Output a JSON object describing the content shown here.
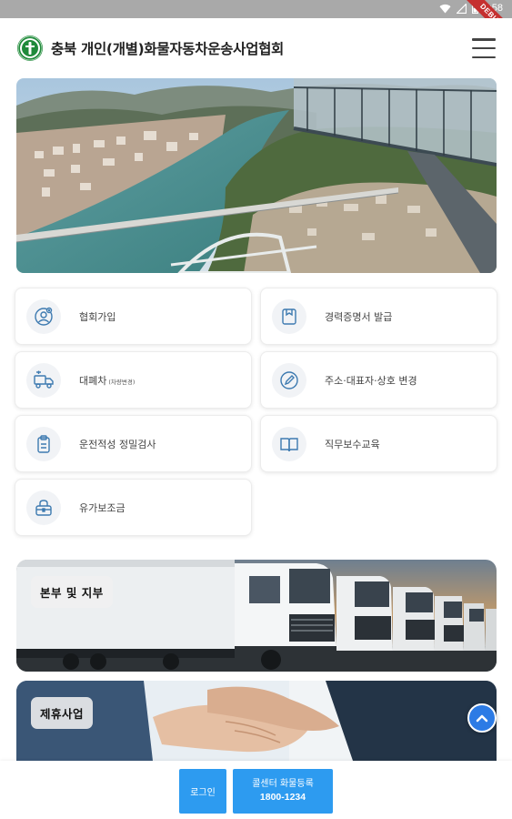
{
  "status_bar": {
    "time": "4:58",
    "ribbon": "DEBUG",
    "icons": [
      "wifi-icon",
      "signal-icon",
      "battery-icon"
    ]
  },
  "header": {
    "title": "충북 개인(개별)화물자동차운송사업협회",
    "logo": "association-logo",
    "menu_icon": "hamburger-menu-icon"
  },
  "menu": {
    "items": [
      {
        "label": "협회가입",
        "icon": "user-plus-icon"
      },
      {
        "label": "경력증명서 발급",
        "icon": "document-icon"
      },
      {
        "label": "대폐차",
        "note": "(차량변경)",
        "icon": "truck-icon"
      },
      {
        "label": "주소·대표자·상호 변경",
        "icon": "pencil-icon"
      },
      {
        "label": "운전적성 정밀검사",
        "icon": "clipboard-icon"
      },
      {
        "label": "직무보수교육",
        "icon": "book-icon"
      },
      {
        "label": "유가보조금",
        "icon": "lock-bag-icon"
      }
    ]
  },
  "banners": [
    {
      "label": "본부 및 지부"
    },
    {
      "label": "제휴사업"
    }
  ],
  "bottom_bar": {
    "login_label": "로그인",
    "call_label": "콜센터 화물등록",
    "call_number": "1800-1234"
  },
  "colors": {
    "accent": "#2d9bf0",
    "scroll_top": "#2c7be5",
    "status_bar": "#a9a9a9",
    "logo_green": "#1f8a3a"
  }
}
